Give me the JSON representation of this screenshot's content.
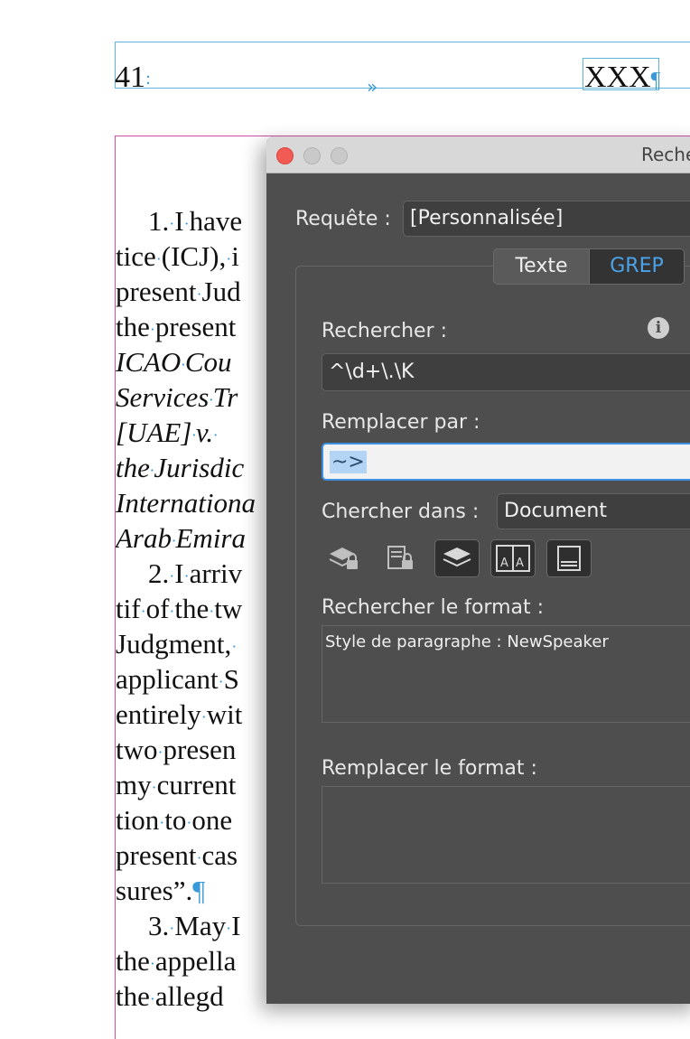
{
  "document": {
    "page_number": "41",
    "header_center_marker": "»",
    "header_right_text": "XXX",
    "pilcrow": "¶",
    "body_lines": [
      [
        "1.·I·have",
        false
      ],
      [
        "tice·(ICJ),·i",
        false
      ],
      [
        "present·Jud",
        false
      ],
      [
        "the·present",
        false
      ],
      [
        "ICAO·Cou",
        true
      ],
      [
        "Services·Tr",
        true
      ],
      [
        "[UAE]·v.·",
        true
      ],
      [
        "the·Jurisdic",
        true
      ],
      [
        "Internationa",
        true
      ],
      [
        "Arab·Emira",
        true
      ],
      [
        "2.·I·arriv",
        false
      ],
      [
        "tif·of·the·tw",
        false
      ],
      [
        "Judgment,·",
        false
      ],
      [
        "applicant·S",
        false
      ],
      [
        "entirely·wit",
        false
      ],
      [
        "two·presen",
        false
      ],
      [
        "my·current",
        false
      ],
      [
        "tion·to·one",
        false
      ],
      [
        "present·cas",
        false
      ],
      [
        "sures”.¶",
        false
      ],
      [
        "3.·May·I",
        false
      ],
      [
        "the·appella",
        false
      ],
      [
        "the·allegd",
        false
      ]
    ]
  },
  "dialog": {
    "title": "Reche",
    "requete_label": "Requête :",
    "requete_value": "[Personnalisée]",
    "tabs": [
      "Texte",
      "GREP"
    ],
    "active_tab": "GREP",
    "rechercher_label": "Rechercher :",
    "rechercher_value": "^\\d+\\.\\K",
    "info_icon": "i",
    "remplacer_label": "Remplacer par :",
    "remplacer_value": "~>",
    "chercher_dans_label": "Chercher dans :",
    "chercher_dans_value": "Document",
    "search_options": [
      {
        "name": "locked-layers-icon",
        "active": false
      },
      {
        "name": "locked-stories-icon",
        "active": false
      },
      {
        "name": "hidden-layers-icon",
        "active": true
      },
      {
        "name": "master-pages-icon",
        "active": true
      },
      {
        "name": "footnotes-icon",
        "active": true
      }
    ],
    "rechercher_format_label": "Rechercher le format :",
    "rechercher_format_value": "Style de paragraphe : NewSpeaker",
    "remplacer_format_label": "Remplacer le format :",
    "remplacer_format_value": "",
    "colors": {
      "accent": "#4aa3e8",
      "panel": "#4e4e4e",
      "frame_blue": "#5fb3d9",
      "frame_magenta": "#d24fa3"
    }
  }
}
